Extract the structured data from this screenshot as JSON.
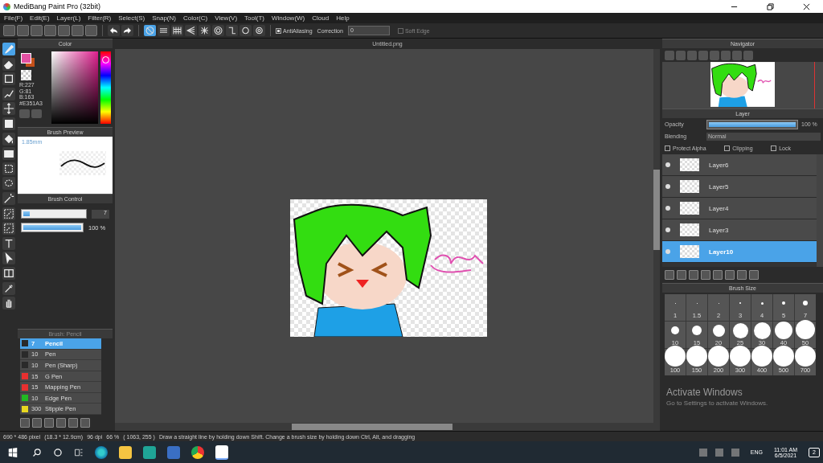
{
  "window": {
    "title": "MediBang Paint Pro (32bit)"
  },
  "menu": [
    "File(F)",
    "Edit(E)",
    "Layer(L)",
    "Filter(R)",
    "Select(S)",
    "Snap(N)",
    "Color(C)",
    "View(V)",
    "Tool(T)",
    "Window(W)",
    "Cloud",
    "Help"
  ],
  "toolbar": {
    "snaps": [
      {
        "kind": "off",
        "selected": true
      },
      {
        "kind": "parallel",
        "selected": false
      },
      {
        "kind": "grid",
        "selected": false
      },
      {
        "kind": "perspective",
        "selected": false
      },
      {
        "kind": "radial",
        "selected": false
      },
      {
        "kind": "concentric",
        "selected": false
      },
      {
        "kind": "curve",
        "selected": false
      },
      {
        "kind": "circle",
        "selected": false
      },
      {
        "kind": "settings",
        "selected": false
      }
    ],
    "antialiasing": {
      "label": "AntiAliasing",
      "checked": true
    },
    "correction": {
      "label": "Correction",
      "value": "0"
    },
    "soft_edge": {
      "label": "Soft Edge",
      "checked": false
    }
  },
  "tools": [
    {
      "kind": "brush",
      "selected": true
    },
    {
      "kind": "eraser",
      "selected": false
    },
    {
      "kind": "dot",
      "selected": false
    },
    {
      "kind": "zigzag",
      "selected": false
    },
    {
      "kind": "move",
      "selected": false
    },
    {
      "kind": "fill",
      "selected": false
    },
    {
      "kind": "bucket",
      "selected": false
    },
    {
      "kind": "gradient",
      "selected": false
    },
    {
      "kind": "select",
      "selected": false
    },
    {
      "kind": "lasso",
      "selected": false
    },
    {
      "kind": "wand",
      "selected": false
    },
    {
      "kind": "selpen",
      "selected": false
    },
    {
      "kind": "selerase",
      "selected": false
    },
    {
      "kind": "text",
      "selected": false
    },
    {
      "kind": "operation",
      "selected": false
    },
    {
      "kind": "divide",
      "selected": false
    },
    {
      "kind": "eyedropper",
      "selected": false
    },
    {
      "kind": "hand",
      "selected": false
    }
  ],
  "color_panel": {
    "title": "Color",
    "hue": {
      "level": 0.92
    },
    "values": [
      "R:227",
      "G:81",
      "B:163",
      "#E351A3"
    ]
  },
  "brush_preview": {
    "title": "Brush Preview",
    "size": "1.85mm"
  },
  "brush_control": {
    "title": "Brush Control",
    "size_slider": {
      "level": 0.1
    },
    "size": "7",
    "opacity_slider": {
      "level": 1
    },
    "opacity": "100 %"
  },
  "brush_list": {
    "title": "Brush: Pencil",
    "items": [
      {
        "size": "7",
        "name": "Pencil",
        "color": "#2a2a2a",
        "selected": true
      },
      {
        "size": "10",
        "name": "Pen",
        "color": "#2a2a2a",
        "selected": false
      },
      {
        "size": "10",
        "name": "Pen (Sharp)",
        "color": "#2a2a2a",
        "selected": false
      },
      {
        "size": "15",
        "name": "G Pen",
        "color": "#e83030",
        "selected": false
      },
      {
        "size": "15",
        "name": "Mapping Pen",
        "color": "#e83030",
        "selected": false
      },
      {
        "size": "10",
        "name": "Edge Pen",
        "color": "#22b822",
        "selected": false
      },
      {
        "size": "300",
        "name": "Stipple Pen",
        "color": "#e8d820",
        "selected": false
      }
    ]
  },
  "canvas": {
    "tab": "Untitled.png"
  },
  "navigator": {
    "title": "Navigator"
  },
  "layer_panel": {
    "title": "Layer",
    "opacity_label": "Opacity",
    "opacity_slider": {
      "level": 1
    },
    "opacity": "100 %",
    "blending_label": "Blending",
    "blending": "Normal",
    "options": [
      {
        "label": "Protect Alpha",
        "checked": false
      },
      {
        "label": "Clipping",
        "checked": false
      },
      {
        "label": "Lock",
        "checked": false
      }
    ],
    "layers": [
      {
        "name": "Layer6",
        "selected": false
      },
      {
        "name": "Layer5",
        "selected": false
      },
      {
        "name": "Layer4",
        "selected": false
      },
      {
        "name": "Layer3",
        "selected": false
      },
      {
        "name": "Layer10",
        "selected": true
      }
    ]
  },
  "brush_size": {
    "title": "Brush Size",
    "sizes": [
      "1",
      "1.5",
      "2",
      "3",
      "4",
      "5",
      "7",
      "10",
      "15",
      "20",
      "25",
      "30",
      "40",
      "50",
      "100",
      "150",
      "200",
      "300",
      "400",
      "500",
      "700"
    ]
  },
  "activation": {
    "title": "Activate Windows",
    "text": "Go to Settings to activate Windows."
  },
  "status_bar": [
    "690 * 486 pixel",
    "(18.3 * 12.9cm)",
    "96 dpi",
    "66 %",
    "( 1063, 255 )",
    "Draw a straight line by holding down Shift. Change a brush size by holding down Ctrl, Alt, and dragging"
  ],
  "taskbar": {
    "language": "ENG",
    "time": "11:01 AM",
    "date": "6/5/2021",
    "notifications": "2"
  }
}
